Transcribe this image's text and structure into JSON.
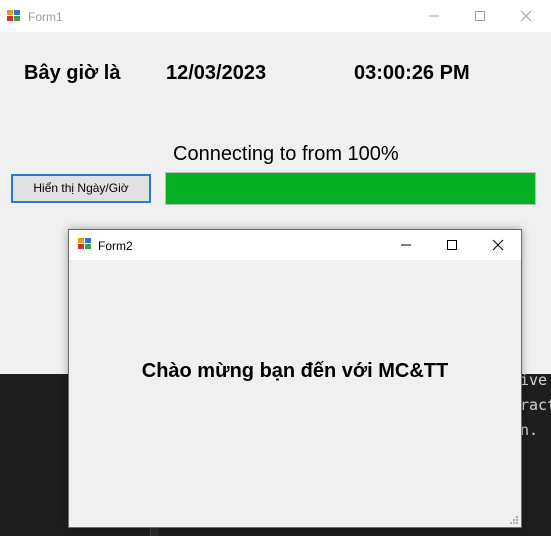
{
  "form1": {
    "title": "Form1",
    "now_label": "Bây giờ là",
    "date": "12/03/2023",
    "time": "03:00:26 PM",
    "status_text": "Connecting to from 100%",
    "show_button_label": "Hiển thị Ngày/Giờ",
    "progress": {
      "value": 100,
      "max": 100,
      "fill_color": "#06b025"
    }
  },
  "form2": {
    "title": "Form2",
    "welcome_text": "Chào mừng bạn đến với MC&TT"
  },
  "editor": {
    "visible_code": "ive\nract\nn."
  }
}
